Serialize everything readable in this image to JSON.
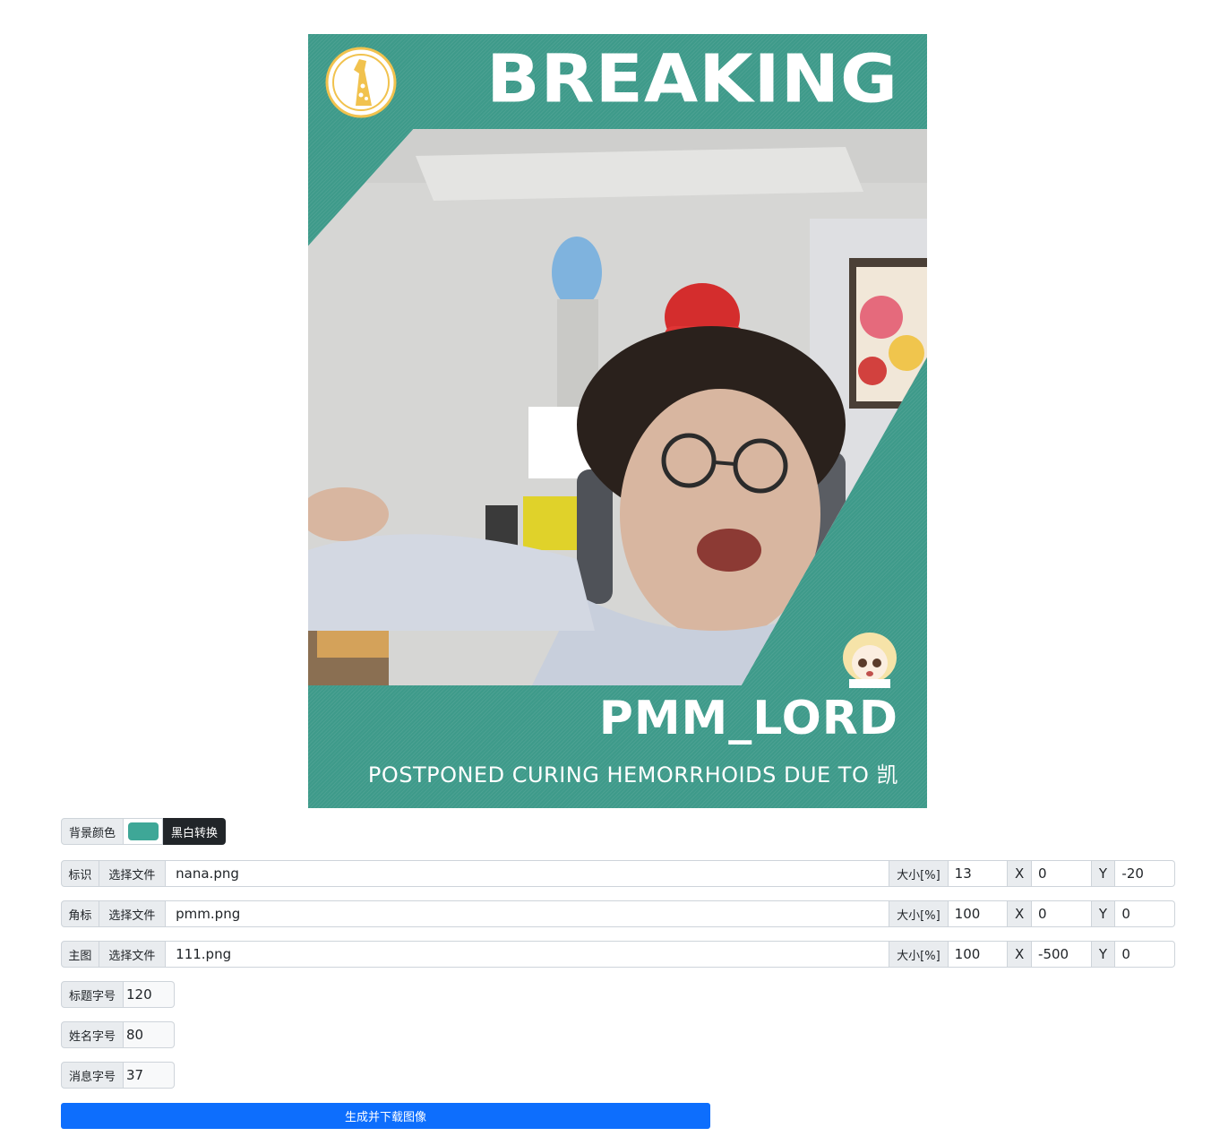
{
  "poster": {
    "title": "BREAKING",
    "name": "PMM_LORD",
    "message": "POSTPONED CURING HEMORRHOIDS DUE TO 凯",
    "background_color": "#3e9a8a"
  },
  "controls": {
    "background": {
      "label": "背景颜色",
      "color_value": "#3ea797",
      "bw_button": "黑白转换"
    },
    "file_rows": [
      {
        "label": "标识",
        "choose": "选择文件",
        "filename": "nana.png",
        "size_label": "大小[%]",
        "size": "13",
        "x_label": "X",
        "x": "0",
        "y_label": "Y",
        "y": "-20"
      },
      {
        "label": "角标",
        "choose": "选择文件",
        "filename": "pmm.png",
        "size_label": "大小[%]",
        "size": "100",
        "x_label": "X",
        "x": "0",
        "y_label": "Y",
        "y": "0"
      },
      {
        "label": "主图",
        "choose": "选择文件",
        "filename": "111.png",
        "size_label": "大小[%]",
        "size": "100",
        "x_label": "X",
        "x": "-500",
        "y_label": "Y",
        "y": "0"
      }
    ],
    "font_sizes": [
      {
        "label": "标题字号",
        "value": "120"
      },
      {
        "label": "姓名字号",
        "value": "80"
      },
      {
        "label": "消息字号",
        "value": "37"
      }
    ],
    "generate_button": "生成并下载图像"
  }
}
